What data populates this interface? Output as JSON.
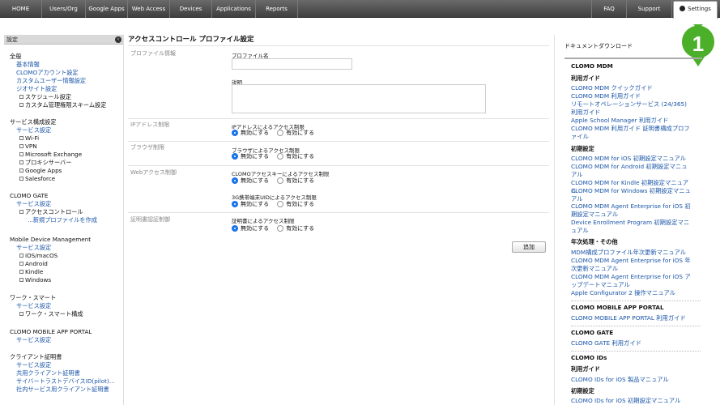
{
  "topnav": {
    "items": [
      "HOME",
      "Users/Org",
      "Google Apps",
      "Web Access",
      "Devices",
      "Applications",
      "Reports"
    ],
    "right_items": [
      "FAQ",
      "Support"
    ],
    "settings_label": "Settings",
    "badge_number": "1"
  },
  "sidebar": {
    "header": "設定",
    "collapse_icon": "‹",
    "groups": [
      {
        "title": "全般",
        "links": [
          "基本情報",
          "CLOMOアカウント設定",
          "カスタムユーザー情報設定",
          "ジオサイト設定"
        ],
        "subs": [
          "スケジュール設定",
          "カスタム管理権限スキーム設定"
        ]
      },
      {
        "title": "サービス構成設定",
        "links": [
          "サービス設定"
        ],
        "subs": [
          "Wi-Fi",
          "VPN",
          "Microsoft Exchange",
          "プロキシサーバー",
          "Google Apps",
          "Salesforce"
        ]
      },
      {
        "title": "CLOMO GATE",
        "links": [
          "サービス設定"
        ],
        "subs": [
          "アクセスコントロール"
        ],
        "subsub": "...新規プロファイルを作成"
      },
      {
        "title": "Mobile Device Management",
        "links": [
          "サービス設定"
        ],
        "subs": [
          "iOS/macOS",
          "Android",
          "Kindle",
          "Windows"
        ]
      },
      {
        "title": "ワーク・スマート",
        "links": [
          "サービス設定"
        ],
        "subs": [
          "ワーク・スマート構成"
        ]
      },
      {
        "title": "CLOMO MOBILE APP PORTAL",
        "links": [
          "サービス設定"
        ]
      },
      {
        "title": "クライアント証明書",
        "links": [
          "サービス設定",
          "共用クライアント証明書",
          "サイバートラストデバイスID(pilot)...",
          "社内サービス用クライアント証明書"
        ]
      }
    ]
  },
  "main": {
    "title": "アクセスコントロール プロファイル設定",
    "sections": {
      "profile_info": "プロファイル情報",
      "ip": "IPアドレス制限",
      "browser": "ブラウザ制限",
      "web": "Webアクセス制御",
      "cert": "証明書認証制御"
    },
    "fields": {
      "profile_name": "プロファイル名",
      "profile_name_value": "",
      "description": "説明",
      "description_value": "",
      "ip_label": "IPアドレスによるアクセス制限",
      "browser_label": "ブラウザによるアクセス制限",
      "web_key_label": "CLOMOアクセスキーによるアクセス制限",
      "web_uid_label": "3G携帯端末UIDによるアクセス制限",
      "cert_label": "証明書によるアクセス制限"
    },
    "radio": {
      "disable": "無効にする",
      "enable": "有効にする"
    },
    "add_button": "追加"
  },
  "downloads": {
    "title": "ドキュメントダウンロード",
    "clomo_mdm": "CLOMO MDM",
    "usage_guide": "利用ガイド",
    "mdm_guide_links": [
      "CLOMO MDM クイックガイド",
      "CLOMO MDM 利用ガイド",
      "リモートオペレーションサービス (24/365) 利用ガイド",
      "Apple School Manager 利用ガイド",
      "CLOMO MDM 利用ガイド 証明書構成プロファイル"
    ],
    "initial_setup": "初期設定",
    "mdm_setup_links": [
      "CLOMO MDM for iOS 初期設定マニュアル",
      "CLOMO MDM for Android 初期設定マニュアル",
      "CLOMO MDM for Kindle 初期設定マニュアル",
      "CLOMO MDM for Windows 初期設定マニュアル",
      "CLOMO MDM Agent Enterprise for iOS 初期設定マニュアル",
      "Device Enrollment Program 初期設定マニュアル"
    ],
    "annual_update": "年次処理・その他",
    "annual_links": [
      "MDM構成プロファイル年次更新マニュアル",
      "CLOMO MDM Agent Enterprise for iOS 年次更新マニュアル",
      "CLOMO MDM Agent Enterprise for iOS アップデートマニュアル",
      "Apple Configurator 2 操作マニュアル"
    ],
    "app_portal": "CLOMO MOBILE APP PORTAL",
    "app_portal_links": [
      "CLOMO MOBILE APP PORTAL 利用ガイド"
    ],
    "gate": "CLOMO GATE",
    "gate_links": [
      "CLOMO GATE 利用ガイド"
    ],
    "ids": "CLOMO IDs",
    "ids_usage": "利用ガイド",
    "ids_usage_links": [
      "CLOMO IDs for iOS 製品マニュアル"
    ],
    "ids_setup": "初期設定",
    "ids_setup_links": [
      "CLOMO IDs for iOS 初期設定マニュアル"
    ]
  },
  "colors": {
    "link": "#1a55a8",
    "badge": "#4caf2a",
    "nav_bg": "#4a4a4a",
    "radio_on": "#1a73e8"
  }
}
